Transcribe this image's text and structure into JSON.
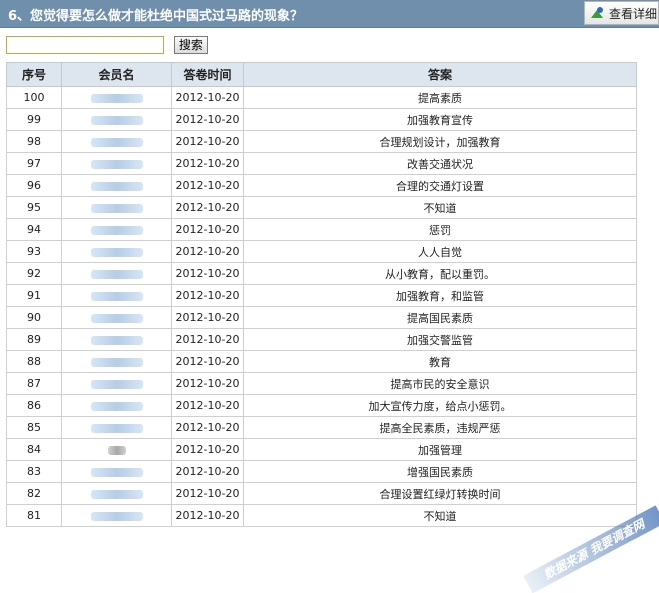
{
  "question": "6、您觉得要怎么做才能杜绝中国式过马路的现象？",
  "view_details_label": "查看详细",
  "view_details_icon": "chart-icon",
  "search": {
    "value": "",
    "button_label": "搜索"
  },
  "table": {
    "headers": [
      "序号",
      "会员名",
      "答卷时间",
      "答案"
    ],
    "rows": [
      {
        "id": "100",
        "date": "2012-10-20",
        "answer": "提高素质"
      },
      {
        "id": "99",
        "date": "2012-10-20",
        "answer": "加强教育宣传"
      },
      {
        "id": "98",
        "date": "2012-10-20",
        "answer": "合理规划设计，加强教育"
      },
      {
        "id": "97",
        "date": "2012-10-20",
        "answer": "改善交通状况"
      },
      {
        "id": "96",
        "date": "2012-10-20",
        "answer": "合理的交通灯设置"
      },
      {
        "id": "95",
        "date": "2012-10-20",
        "answer": "不知道"
      },
      {
        "id": "94",
        "date": "2012-10-20",
        "answer": "惩罚"
      },
      {
        "id": "93",
        "date": "2012-10-20",
        "answer": "人人自觉"
      },
      {
        "id": "92",
        "date": "2012-10-20",
        "answer": "从小教育，配以重罚。"
      },
      {
        "id": "91",
        "date": "2012-10-20",
        "answer": "加强教育，和监管"
      },
      {
        "id": "90",
        "date": "2012-10-20",
        "answer": "提高国民素质"
      },
      {
        "id": "89",
        "date": "2012-10-20",
        "answer": "加强交警监管"
      },
      {
        "id": "88",
        "date": "2012-10-20",
        "answer": "教育"
      },
      {
        "id": "87",
        "date": "2012-10-20",
        "answer": "提高市民的安全意识"
      },
      {
        "id": "86",
        "date": "2012-10-20",
        "answer": "加大宣传力度，给点小惩罚。"
      },
      {
        "id": "85",
        "date": "2012-10-20",
        "answer": "提高全民素质，违规严惩"
      },
      {
        "id": "84",
        "date": "2012-10-20",
        "answer": "加强管理"
      },
      {
        "id": "83",
        "date": "2012-10-20",
        "answer": "增强国民素质"
      },
      {
        "id": "82",
        "date": "2012-10-20",
        "answer": "合理设置红绿灯转换时间"
      },
      {
        "id": "81",
        "date": "2012-10-20",
        "answer": "不知道"
      }
    ]
  },
  "watermark": "数据来源 我要调查网"
}
